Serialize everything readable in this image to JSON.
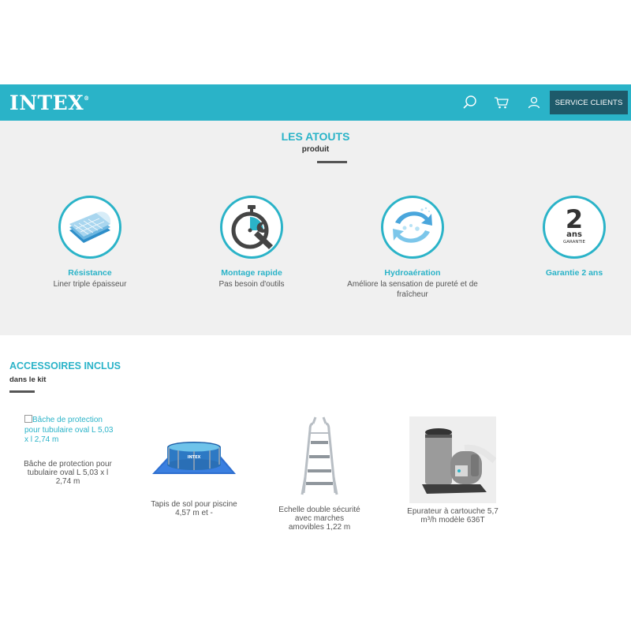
{
  "header": {
    "logo": "INTEX",
    "logo_mark": "®",
    "service_label": "SERVICE CLIENTS",
    "icons": [
      "search-icon",
      "cart-icon",
      "user-icon"
    ],
    "brand_color": "#2ab3c8"
  },
  "atouts": {
    "title": "LES ATOUTS",
    "subtitle": "produit",
    "features": [
      {
        "title": "Résistance",
        "desc": "Liner triple épaisseur",
        "icon": "liner-layers-icon"
      },
      {
        "title": "Montage rapide",
        "desc": "Pas besoin d'outils",
        "icon": "stopwatch-wrench-icon"
      },
      {
        "title": "Hydroaération",
        "desc": "Améliore la sensation de pureté et de fraîcheur",
        "icon": "water-aeration-icon"
      },
      {
        "title": "Garantie 2 ans",
        "desc": "",
        "icon": "warranty-2-years-icon",
        "badge_number": "2",
        "badge_unit": "ans",
        "badge_text": "GARANTIE"
      }
    ]
  },
  "accessoires": {
    "title": "ACCESSOIRES INCLUS",
    "subtitle": "dans le kit",
    "items": [
      {
        "alt": "Bâche de protection pour tubulaire oval L 5,03 x l 2,74 m",
        "label": "Bâche de protection pour tubulaire oval L 5,03 x l 2,74 m"
      },
      {
        "label": "Tapis de sol pour piscine 4,57 m et -",
        "img_brand": "INTEX"
      },
      {
        "label": "Echelle double sécurité avec marches amovibles 1,22 m"
      },
      {
        "label": "Epurateur à cartouche 5,7 m³/h modèle 636T"
      }
    ]
  }
}
